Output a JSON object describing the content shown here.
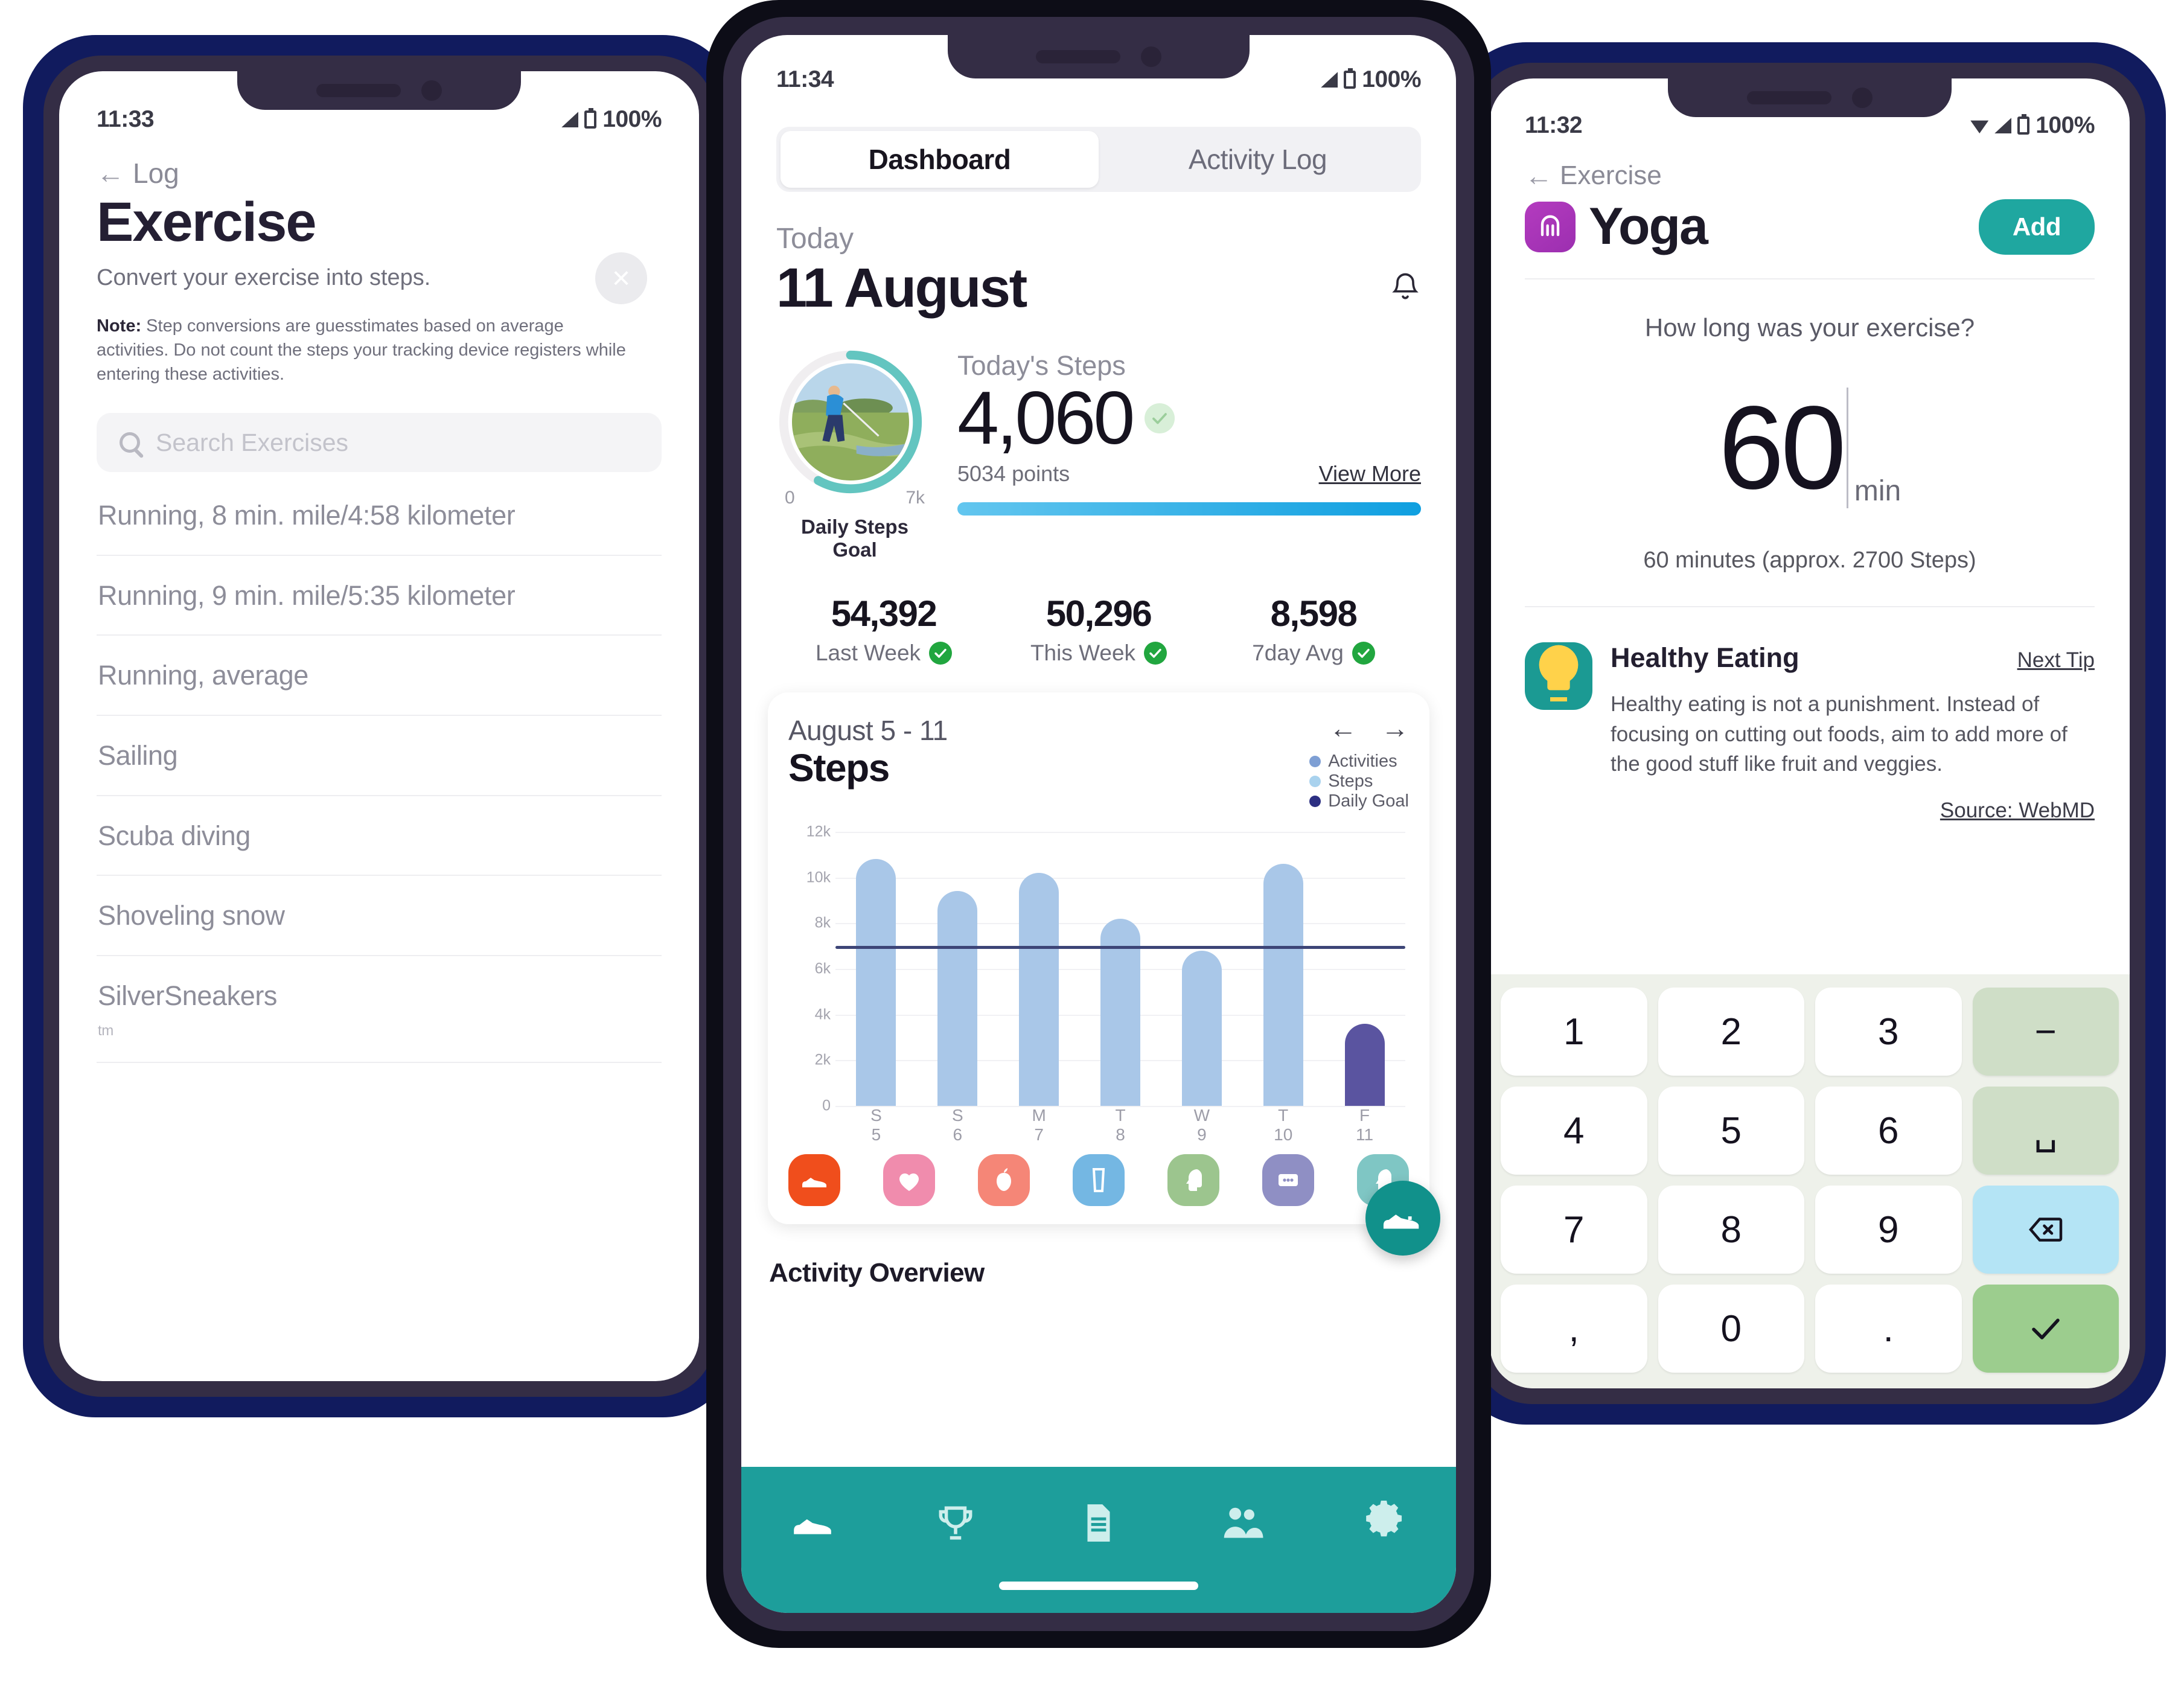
{
  "colors": {
    "frame_navy": "#111b5e",
    "bezel": "#342d45",
    "teal": "#1d9e9b",
    "teal_button": "#1fa7a0",
    "bar_steps": "#a9c7e8",
    "bar_goal": "#5a54a0",
    "goal_line": "#3d4577",
    "yoga_purple": "#a32fb4"
  },
  "left_phone": {
    "status": {
      "time": "11:33",
      "battery": "100%"
    },
    "back_label": "Log",
    "title": "Exercise",
    "subtitle": "Convert your exercise into steps.",
    "note_bold": "Note:",
    "note_text": " Step conversions are guesstimates based on average activities. Do not count the steps your tracking device registers while entering these activities.",
    "close_label": "×",
    "search": {
      "placeholder": "Search Exercises",
      "icon": "search-icon"
    },
    "exercises": [
      {
        "name": "Running, 8 min. mile/4:58 kilometer",
        "tm": ""
      },
      {
        "name": "Running, 9 min. mile/5:35 kilometer",
        "tm": ""
      },
      {
        "name": "Running, average",
        "tm": ""
      },
      {
        "name": "Sailing",
        "tm": ""
      },
      {
        "name": "Scuba diving",
        "tm": ""
      },
      {
        "name": "Shoveling snow",
        "tm": ""
      },
      {
        "name": "SilverSneakers",
        "tm": "tm"
      }
    ]
  },
  "mid_phone": {
    "status": {
      "time": "11:34",
      "battery": "100%"
    },
    "tabs": [
      {
        "label": "Dashboard",
        "active": true
      },
      {
        "label": "Activity Log",
        "active": false
      }
    ],
    "today_label": "Today",
    "date": "11 August",
    "bell_icon": "bell-icon",
    "ring": {
      "min": "0",
      "max": "7k",
      "caption": "Daily Steps Goal",
      "progress_pct": 58
    },
    "steps": {
      "label": "Today's Steps",
      "value": "4,060",
      "points": "5034 points",
      "view_more": "View More",
      "progress_pct": 100
    },
    "kpis": [
      {
        "value": "54,392",
        "label": "Last Week"
      },
      {
        "value": "50,296",
        "label": "This Week"
      },
      {
        "value": "8,598",
        "label": "7day Avg"
      }
    ],
    "chart_card": {
      "range": "August 5 - 11",
      "title": "Steps",
      "prev_arrow": "←",
      "next_arrow": "→"
    },
    "quick_icons": [
      {
        "name": "shoe-icon",
        "color": "#f04e1c"
      },
      {
        "name": "heart-icon",
        "color": "#f08cad"
      },
      {
        "name": "apple-icon",
        "color": "#f58677"
      },
      {
        "name": "water-glass-icon",
        "color": "#74b7e3"
      },
      {
        "name": "mind-icon",
        "color": "#9cc58e"
      },
      {
        "name": "sleep-icon",
        "color": "#8f8fc4"
      },
      {
        "name": "head-plus-icon",
        "color": "#7fc6c4"
      }
    ],
    "fab_icon": "add-shoe-icon",
    "activity_overview": "Activity Overview",
    "navbar": [
      {
        "name": "shoe-icon"
      },
      {
        "name": "trophy-icon"
      },
      {
        "name": "document-icon"
      },
      {
        "name": "people-icon"
      },
      {
        "name": "gear-icon"
      }
    ]
  },
  "right_phone": {
    "status": {
      "time": "11:32",
      "battery": "100%"
    },
    "back_label": "Exercise",
    "title": "Yoga",
    "icon": "yoga-icon",
    "add_label": "Add",
    "question": "How long was your exercise?",
    "duration_value": "60",
    "duration_unit": "min",
    "approx": "60 minutes (approx. 2700 Steps)",
    "tip": {
      "icon": "lightbulb-icon",
      "title": "Healthy Eating",
      "next_label": "Next Tip",
      "body": "Healthy eating is not a punishment. Instead of focusing on cutting out foods, aim to add more of the good stuff like fruit and veggies.",
      "source": "Source: WebMD"
    },
    "keypad": [
      {
        "label": "1",
        "type": "num"
      },
      {
        "label": "2",
        "type": "num"
      },
      {
        "label": "3",
        "type": "num"
      },
      {
        "label": "−",
        "type": "fn"
      },
      {
        "label": "4",
        "type": "num"
      },
      {
        "label": "5",
        "type": "num"
      },
      {
        "label": "6",
        "type": "num"
      },
      {
        "label": "␣",
        "type": "fn"
      },
      {
        "label": "7",
        "type": "num"
      },
      {
        "label": "8",
        "type": "num"
      },
      {
        "label": "9",
        "type": "num"
      },
      {
        "label": "",
        "type": "del"
      },
      {
        "label": ",",
        "type": "num"
      },
      {
        "label": "0",
        "type": "num"
      },
      {
        "label": ".",
        "type": "num"
      },
      {
        "label": "",
        "type": "ok"
      }
    ]
  },
  "chart_data": {
    "type": "bar",
    "title": "Steps",
    "subtitle": "August 5 - 11",
    "categories": [
      "S\n5",
      "S\n6",
      "M\n7",
      "T\n8",
      "W\n9",
      "T\n10",
      "F\n11"
    ],
    "tick_labels": [
      {
        "day": "S",
        "num": "5"
      },
      {
        "day": "S",
        "num": "6"
      },
      {
        "day": "M",
        "num": "7"
      },
      {
        "day": "T",
        "num": "8"
      },
      {
        "day": "W",
        "num": "9"
      },
      {
        "day": "T",
        "num": "10"
      },
      {
        "day": "F",
        "num": "11"
      }
    ],
    "values": [
      10800,
      9400,
      10200,
      8200,
      6800,
      10600,
      3600
    ],
    "bar_colors": [
      "#a9c7e8",
      "#a9c7e8",
      "#a9c7e8",
      "#a9c7e8",
      "#a9c7e8",
      "#a9c7e8",
      "#5a54a0"
    ],
    "ylim": [
      0,
      12000
    ],
    "yticks": [
      0,
      2000,
      4000,
      6000,
      8000,
      10000,
      12000
    ],
    "ytick_labels": [
      "0",
      "2k",
      "4k",
      "6k",
      "8k",
      "10k",
      "12k"
    ],
    "reference_line": {
      "name": "Daily Goal",
      "value": 7000,
      "color": "#3d4577"
    },
    "legend": [
      {
        "label": "Activities",
        "color": "#7e9fd4"
      },
      {
        "label": "Steps",
        "color": "#a9d2ee"
      },
      {
        "label": "Daily Goal",
        "color": "#2c2f82"
      }
    ],
    "legend_position": "top-right",
    "grid": true,
    "xlabel": "",
    "ylabel": ""
  }
}
